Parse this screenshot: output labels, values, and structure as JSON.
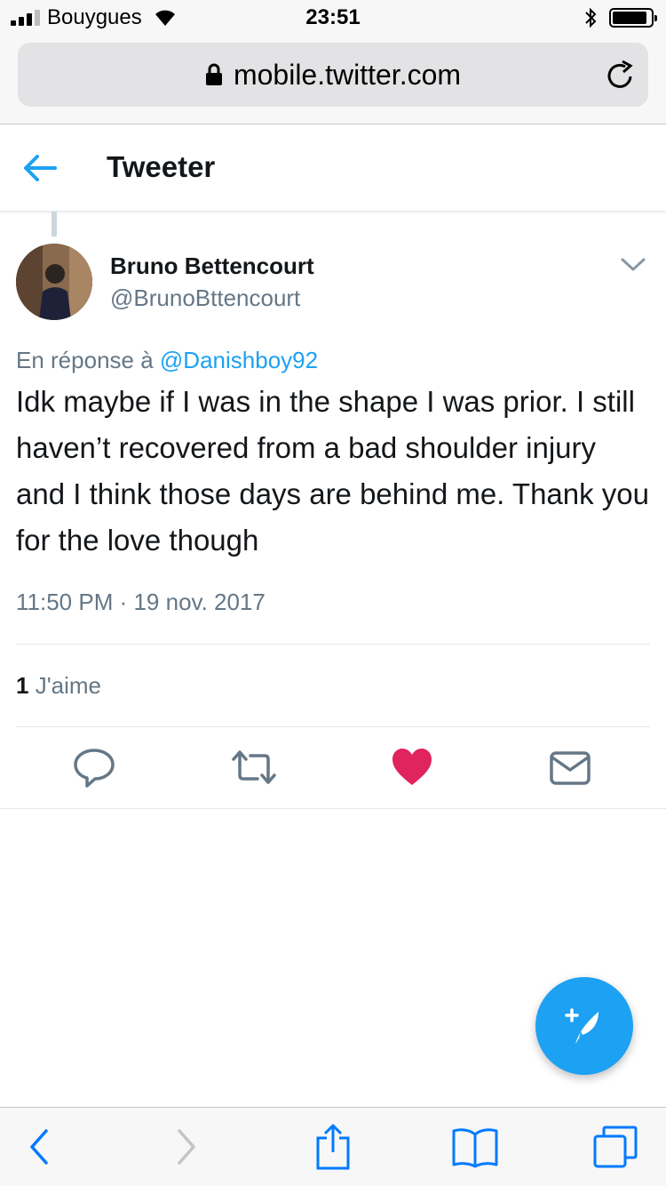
{
  "status_bar": {
    "carrier": "Bouygues",
    "time": "23:51",
    "signal_bars_filled": 3,
    "signal_bars_total": 4,
    "battery_level": 0.9
  },
  "browser": {
    "url": "mobile.twitter.com",
    "lock_icon": "lock-icon",
    "reload_icon": "reload-icon"
  },
  "header": {
    "title": "Tweeter",
    "back_icon": "back-arrow-icon"
  },
  "tweet": {
    "author_name": "Bruno Bettencourt",
    "author_handle": "@BrunoBttencourt",
    "reply_prefix": "En réponse à",
    "reply_mention": "@Danishboy92",
    "text": "Idk maybe if I was in the shape I was prior. I still haven’t recovered from a bad shoulder injury and I think those days are behind me. Thank you for the love though",
    "timestamp": "11:50 PM · 19 nov. 2017",
    "likes_count": "1",
    "likes_label": "J'aime",
    "liked": true
  },
  "actions": [
    "reply-icon",
    "retweet-icon",
    "heart-icon",
    "mail-icon"
  ],
  "colors": {
    "accent": "#1da1f2",
    "like": "#e0245e",
    "secondary_text": "#657786",
    "safari_blue": "#007aff"
  },
  "fab": {
    "icon": "compose-tweet-icon"
  },
  "safari_toolbar": [
    "back-icon",
    "forward-icon",
    "share-icon",
    "bookmarks-icon",
    "tabs-icon"
  ]
}
